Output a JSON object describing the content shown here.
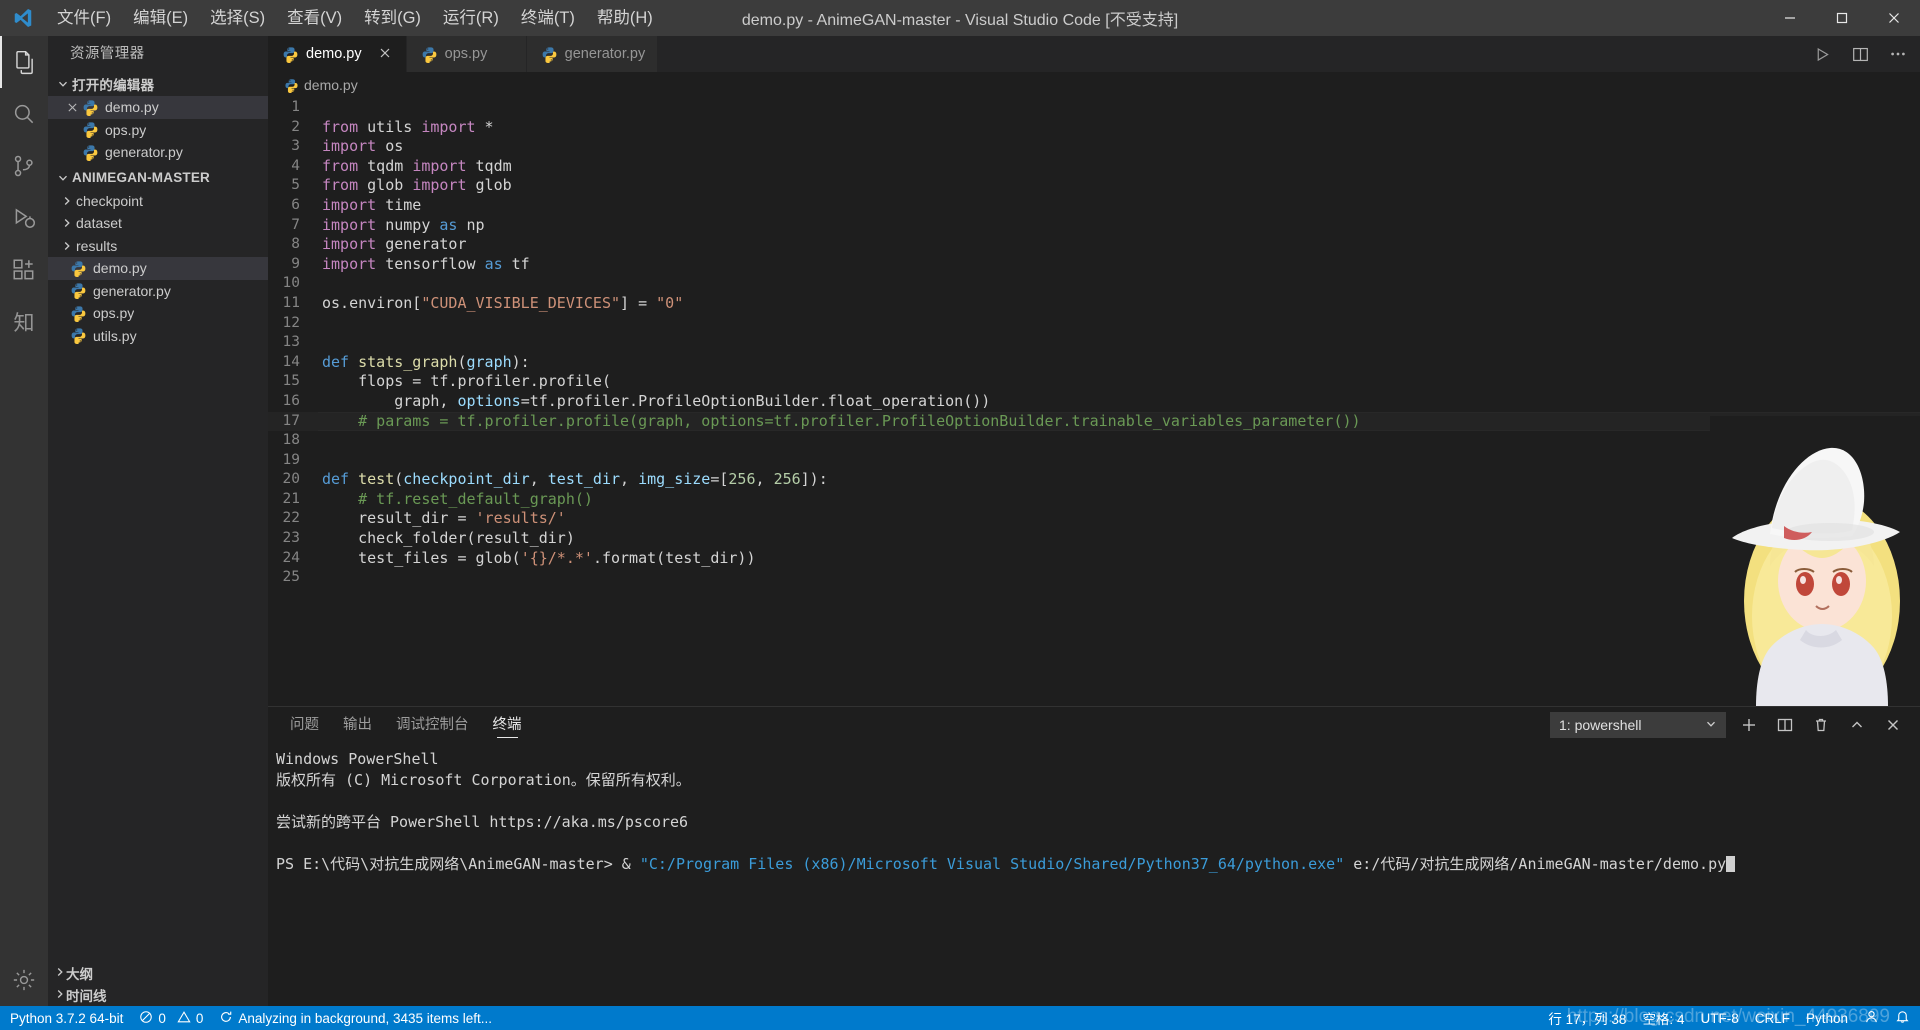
{
  "titlebar": {
    "title": "demo.py - AnimeGAN-master - Visual Studio Code [不受支持]",
    "logo_name": "vscode-logo",
    "menu": [
      {
        "label": "文件(F)"
      },
      {
        "label": "编辑(E)"
      },
      {
        "label": "选择(S)"
      },
      {
        "label": "查看(V)"
      },
      {
        "label": "转到(G)"
      },
      {
        "label": "运行(R)"
      },
      {
        "label": "终端(T)"
      },
      {
        "label": "帮助(H)"
      }
    ],
    "window_controls": [
      "minimize",
      "maximize",
      "close"
    ]
  },
  "activitybar": {
    "items": [
      {
        "name": "explorer",
        "icon": "files-icon",
        "active": true
      },
      {
        "name": "search",
        "icon": "search-icon",
        "active": false
      },
      {
        "name": "source-control",
        "icon": "source-control-icon",
        "active": false
      },
      {
        "name": "run-debug",
        "icon": "run-debug-icon",
        "active": false
      },
      {
        "name": "extensions",
        "icon": "extensions-icon",
        "active": false
      },
      {
        "name": "knowledge",
        "icon": "zhi-icon",
        "glyph": "知",
        "active": false
      }
    ],
    "bottom": [
      {
        "name": "manage",
        "icon": "gear-icon"
      }
    ]
  },
  "sidebar": {
    "title": "资源管理器",
    "open_editors": {
      "label": "打开的编辑器",
      "expanded": true,
      "items": [
        {
          "label": "demo.py",
          "icon": "python-icon",
          "selected": true,
          "closable": true
        },
        {
          "label": "ops.py",
          "icon": "python-icon",
          "selected": false,
          "closable": false
        },
        {
          "label": "generator.py",
          "icon": "python-icon",
          "selected": false,
          "closable": false
        }
      ]
    },
    "workspace": {
      "label": "ANIMEGAN-MASTER",
      "expanded": true,
      "items": [
        {
          "label": "checkpoint",
          "type": "folder",
          "expanded": false
        },
        {
          "label": "dataset",
          "type": "folder",
          "expanded": false
        },
        {
          "label": "results",
          "type": "folder",
          "expanded": false
        },
        {
          "label": "demo.py",
          "type": "file",
          "icon": "python-icon",
          "selected": true
        },
        {
          "label": "generator.py",
          "type": "file",
          "icon": "python-icon",
          "selected": false
        },
        {
          "label": "ops.py",
          "type": "file",
          "icon": "python-icon",
          "selected": false
        },
        {
          "label": "utils.py",
          "type": "file",
          "icon": "python-icon",
          "selected": false
        }
      ]
    },
    "collapsed_sections": [
      {
        "label": "大纲"
      },
      {
        "label": "时间线"
      }
    ]
  },
  "editor": {
    "tabs": [
      {
        "label": "demo.py",
        "icon": "python-icon",
        "active": true,
        "closable": true
      },
      {
        "label": "ops.py",
        "icon": "python-icon",
        "active": false,
        "closable": false
      },
      {
        "label": "generator.py",
        "icon": "python-icon",
        "active": false,
        "closable": false
      }
    ],
    "tab_actions": [
      {
        "name": "run-file",
        "icon": "play-icon"
      },
      {
        "name": "split-editor",
        "icon": "split-editor-icon"
      },
      {
        "name": "more-actions",
        "icon": "ellipsis-icon"
      }
    ],
    "breadcrumb": "demo.py",
    "highlight_line": 17,
    "lines": [
      {
        "n": 1,
        "tokens": []
      },
      {
        "n": 2,
        "tokens": [
          {
            "t": "from ",
            "c": "kw"
          },
          {
            "t": "utils ",
            "c": "plain"
          },
          {
            "t": "import",
            "c": "kw"
          },
          {
            "t": " *",
            "c": "plain"
          }
        ]
      },
      {
        "n": 3,
        "tokens": [
          {
            "t": "import",
            "c": "kw"
          },
          {
            "t": " os",
            "c": "plain"
          }
        ]
      },
      {
        "n": 4,
        "tokens": [
          {
            "t": "from ",
            "c": "kw"
          },
          {
            "t": "tqdm ",
            "c": "plain"
          },
          {
            "t": "import",
            "c": "kw"
          },
          {
            "t": " tqdm",
            "c": "plain"
          }
        ]
      },
      {
        "n": 5,
        "tokens": [
          {
            "t": "from ",
            "c": "kw"
          },
          {
            "t": "glob ",
            "c": "plain"
          },
          {
            "t": "import",
            "c": "kw"
          },
          {
            "t": " glob",
            "c": "plain"
          }
        ]
      },
      {
        "n": 6,
        "tokens": [
          {
            "t": "import",
            "c": "kw"
          },
          {
            "t": " time",
            "c": "plain"
          }
        ]
      },
      {
        "n": 7,
        "tokens": [
          {
            "t": "import",
            "c": "kw"
          },
          {
            "t": " numpy ",
            "c": "plain"
          },
          {
            "t": "as",
            "c": "kw2"
          },
          {
            "t": " np",
            "c": "plain"
          }
        ]
      },
      {
        "n": 8,
        "tokens": [
          {
            "t": "import",
            "c": "kw"
          },
          {
            "t": " generator",
            "c": "plain"
          }
        ]
      },
      {
        "n": 9,
        "tokens": [
          {
            "t": "import",
            "c": "kw"
          },
          {
            "t": " tensorflow ",
            "c": "plain"
          },
          {
            "t": "as",
            "c": "kw2"
          },
          {
            "t": " tf",
            "c": "plain"
          }
        ]
      },
      {
        "n": 10,
        "tokens": []
      },
      {
        "n": 11,
        "tokens": [
          {
            "t": "os.environ[",
            "c": "plain"
          },
          {
            "t": "\"CUDA_VISIBLE_DEVICES\"",
            "c": "str"
          },
          {
            "t": "] = ",
            "c": "plain"
          },
          {
            "t": "\"0\"",
            "c": "str"
          }
        ]
      },
      {
        "n": 12,
        "tokens": []
      },
      {
        "n": 13,
        "tokens": []
      },
      {
        "n": 14,
        "tokens": [
          {
            "t": "def ",
            "c": "kw2"
          },
          {
            "t": "stats_graph",
            "c": "fn"
          },
          {
            "t": "(",
            "c": "plain"
          },
          {
            "t": "graph",
            "c": "par"
          },
          {
            "t": "):",
            "c": "plain"
          }
        ]
      },
      {
        "n": 15,
        "tokens": [
          {
            "t": "    flops = tf.profiler.profile(",
            "c": "plain"
          }
        ]
      },
      {
        "n": 16,
        "tokens": [
          {
            "t": "        graph, ",
            "c": "plain"
          },
          {
            "t": "options",
            "c": "par"
          },
          {
            "t": "=tf.profiler.ProfileOptionBuilder.float_operation())",
            "c": "plain"
          }
        ]
      },
      {
        "n": 17,
        "tokens": [
          {
            "t": "    # params = tf.profiler.profile(graph, options=tf.profiler.ProfileOptionBuilder.trainable_variables_parameter())",
            "c": "cmt"
          }
        ]
      },
      {
        "n": 18,
        "tokens": []
      },
      {
        "n": 19,
        "tokens": []
      },
      {
        "n": 20,
        "tokens": [
          {
            "t": "def ",
            "c": "kw2"
          },
          {
            "t": "test",
            "c": "fn"
          },
          {
            "t": "(",
            "c": "plain"
          },
          {
            "t": "checkpoint_dir",
            "c": "par"
          },
          {
            "t": ", ",
            "c": "plain"
          },
          {
            "t": "test_dir",
            "c": "par"
          },
          {
            "t": ", ",
            "c": "plain"
          },
          {
            "t": "img_size",
            "c": "par"
          },
          {
            "t": "=[",
            "c": "plain"
          },
          {
            "t": "256",
            "c": "num"
          },
          {
            "t": ", ",
            "c": "plain"
          },
          {
            "t": "256",
            "c": "num"
          },
          {
            "t": "]):",
            "c": "plain"
          }
        ]
      },
      {
        "n": 21,
        "tokens": [
          {
            "t": "    # tf.reset_default_graph()",
            "c": "cmt"
          }
        ]
      },
      {
        "n": 22,
        "tokens": [
          {
            "t": "    result_dir = ",
            "c": "plain"
          },
          {
            "t": "'results/'",
            "c": "str"
          }
        ]
      },
      {
        "n": 23,
        "tokens": [
          {
            "t": "    check_folder(result_dir)",
            "c": "plain"
          }
        ]
      },
      {
        "n": 24,
        "tokens": [
          {
            "t": "    test_files = glob(",
            "c": "plain"
          },
          {
            "t": "'{}/*.*'",
            "c": "str"
          },
          {
            "t": ".format(test_dir))",
            "c": "plain"
          }
        ]
      },
      {
        "n": 25,
        "tokens": []
      }
    ]
  },
  "panel": {
    "tabs": [
      {
        "label": "问题",
        "active": false
      },
      {
        "label": "输出",
        "active": false
      },
      {
        "label": "调试控制台",
        "active": false
      },
      {
        "label": "终端",
        "active": true
      }
    ],
    "terminal_select": "1: powershell",
    "actions": [
      {
        "name": "new-terminal",
        "icon": "plus-icon"
      },
      {
        "name": "split-terminal",
        "icon": "split-icon"
      },
      {
        "name": "kill-terminal",
        "icon": "trash-icon"
      },
      {
        "name": "maximize-panel",
        "icon": "chevron-up-icon"
      },
      {
        "name": "close-panel",
        "icon": "close-icon"
      }
    ],
    "terminal_lines": [
      {
        "segments": [
          {
            "t": "Windows PowerShell",
            "c": "plain"
          }
        ]
      },
      {
        "segments": [
          {
            "t": "版权所有 (C) Microsoft Corporation。保留所有权利。",
            "c": "plain"
          }
        ]
      },
      {
        "segments": [
          {
            "t": "",
            "c": "plain"
          }
        ]
      },
      {
        "segments": [
          {
            "t": "尝试新的跨平台 PowerShell https://aka.ms/pscore6",
            "c": "plain"
          }
        ]
      },
      {
        "segments": [
          {
            "t": "",
            "c": "plain"
          }
        ]
      },
      {
        "segments": [
          {
            "t": "PS E:\\代码\\对抗生成网络\\AnimeGAN-master> & ",
            "c": "plain"
          },
          {
            "t": "\"C:/Program Files (x86)/Microsoft Visual Studio/Shared/Python37_64/python.exe\"",
            "c": "t-blue"
          },
          {
            "t": " e:/代码/对抗生成网络/AnimeGAN-master/demo.py",
            "c": "plain"
          },
          {
            "t": "CURSOR",
            "c": "cursor"
          }
        ]
      }
    ]
  },
  "statusbar": {
    "left": [
      {
        "name": "python-interpreter",
        "label": "Python 3.7.2 64-bit"
      },
      {
        "name": "problems",
        "label": "0",
        "label2": "0",
        "icon": "error-warning-icon"
      },
      {
        "name": "background-task",
        "label": "Analyzing in background, 3435 items left...",
        "icon": "sync-icon"
      }
    ],
    "right": [
      {
        "name": "cursor-position",
        "label": "行 17，列 38"
      },
      {
        "name": "indentation",
        "label": "空格: 4"
      },
      {
        "name": "encoding",
        "label": "UTF-8"
      },
      {
        "name": "eol",
        "label": "CRLF"
      },
      {
        "name": "language-mode",
        "label": "Python"
      },
      {
        "name": "accounts",
        "icon": "account-icon"
      },
      {
        "name": "notifications",
        "icon": "bell-icon"
      }
    ]
  },
  "watermark": "https://blog.csdn.net/weixin_44936899",
  "colors": {
    "accent": "#007acc",
    "titlebar_bg": "#3c3c3c",
    "sidebar_bg": "#252526",
    "editor_bg": "#1e1e1e",
    "activitybar_bg": "#333333"
  }
}
